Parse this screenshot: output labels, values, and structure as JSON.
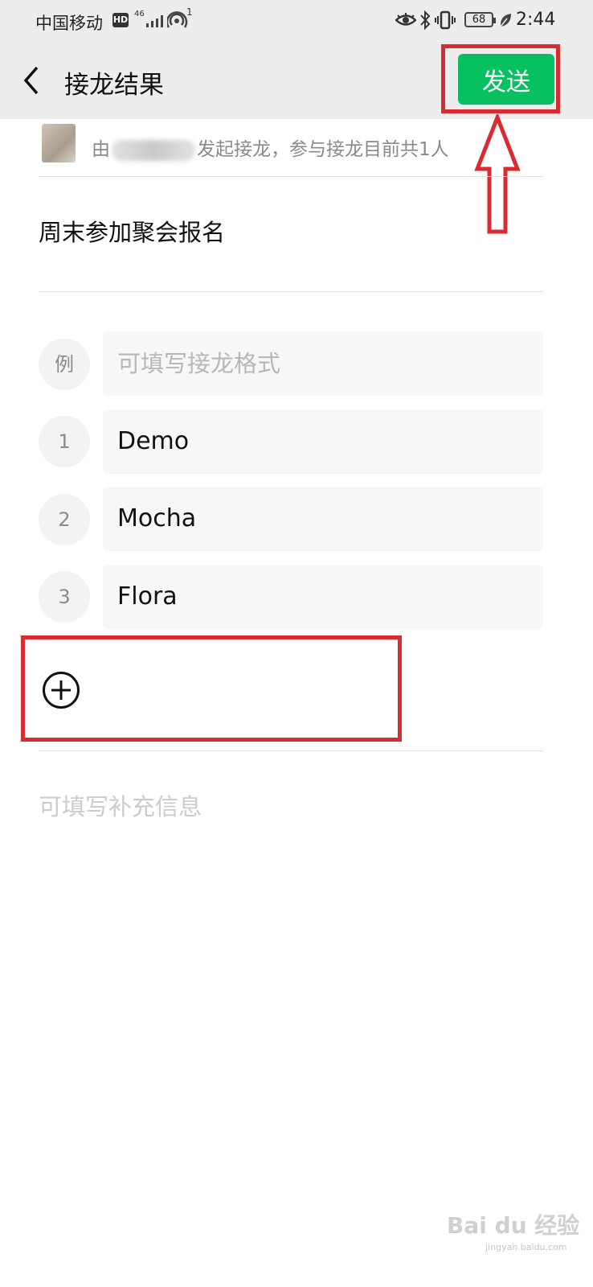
{
  "status_bar": {
    "carrier": "中国移动",
    "hd_badge": "HD",
    "network_type": "46",
    "hotspot_count": "1",
    "battery": "68",
    "time": "2:44"
  },
  "header": {
    "title": "接龙结果",
    "send_label": "发送",
    "accent_color": "#07c160"
  },
  "initiator_line": {
    "prefix": "由",
    "suffix": "发起接龙，参与接龙目前共1人"
  },
  "topic": "周末参加聚会报名",
  "example_row": {
    "badge": "例",
    "placeholder": "可填写接龙格式"
  },
  "entries": [
    {
      "index": "1",
      "name": "Demo"
    },
    {
      "index": "2",
      "name": "Mocha"
    },
    {
      "index": "3",
      "name": "Flora"
    }
  ],
  "extra_info_placeholder": "可填写补充信息",
  "annotation_color": "#d82b32",
  "watermark": {
    "brand": "Bai du 经验",
    "url": "jingyan.baidu.com"
  }
}
